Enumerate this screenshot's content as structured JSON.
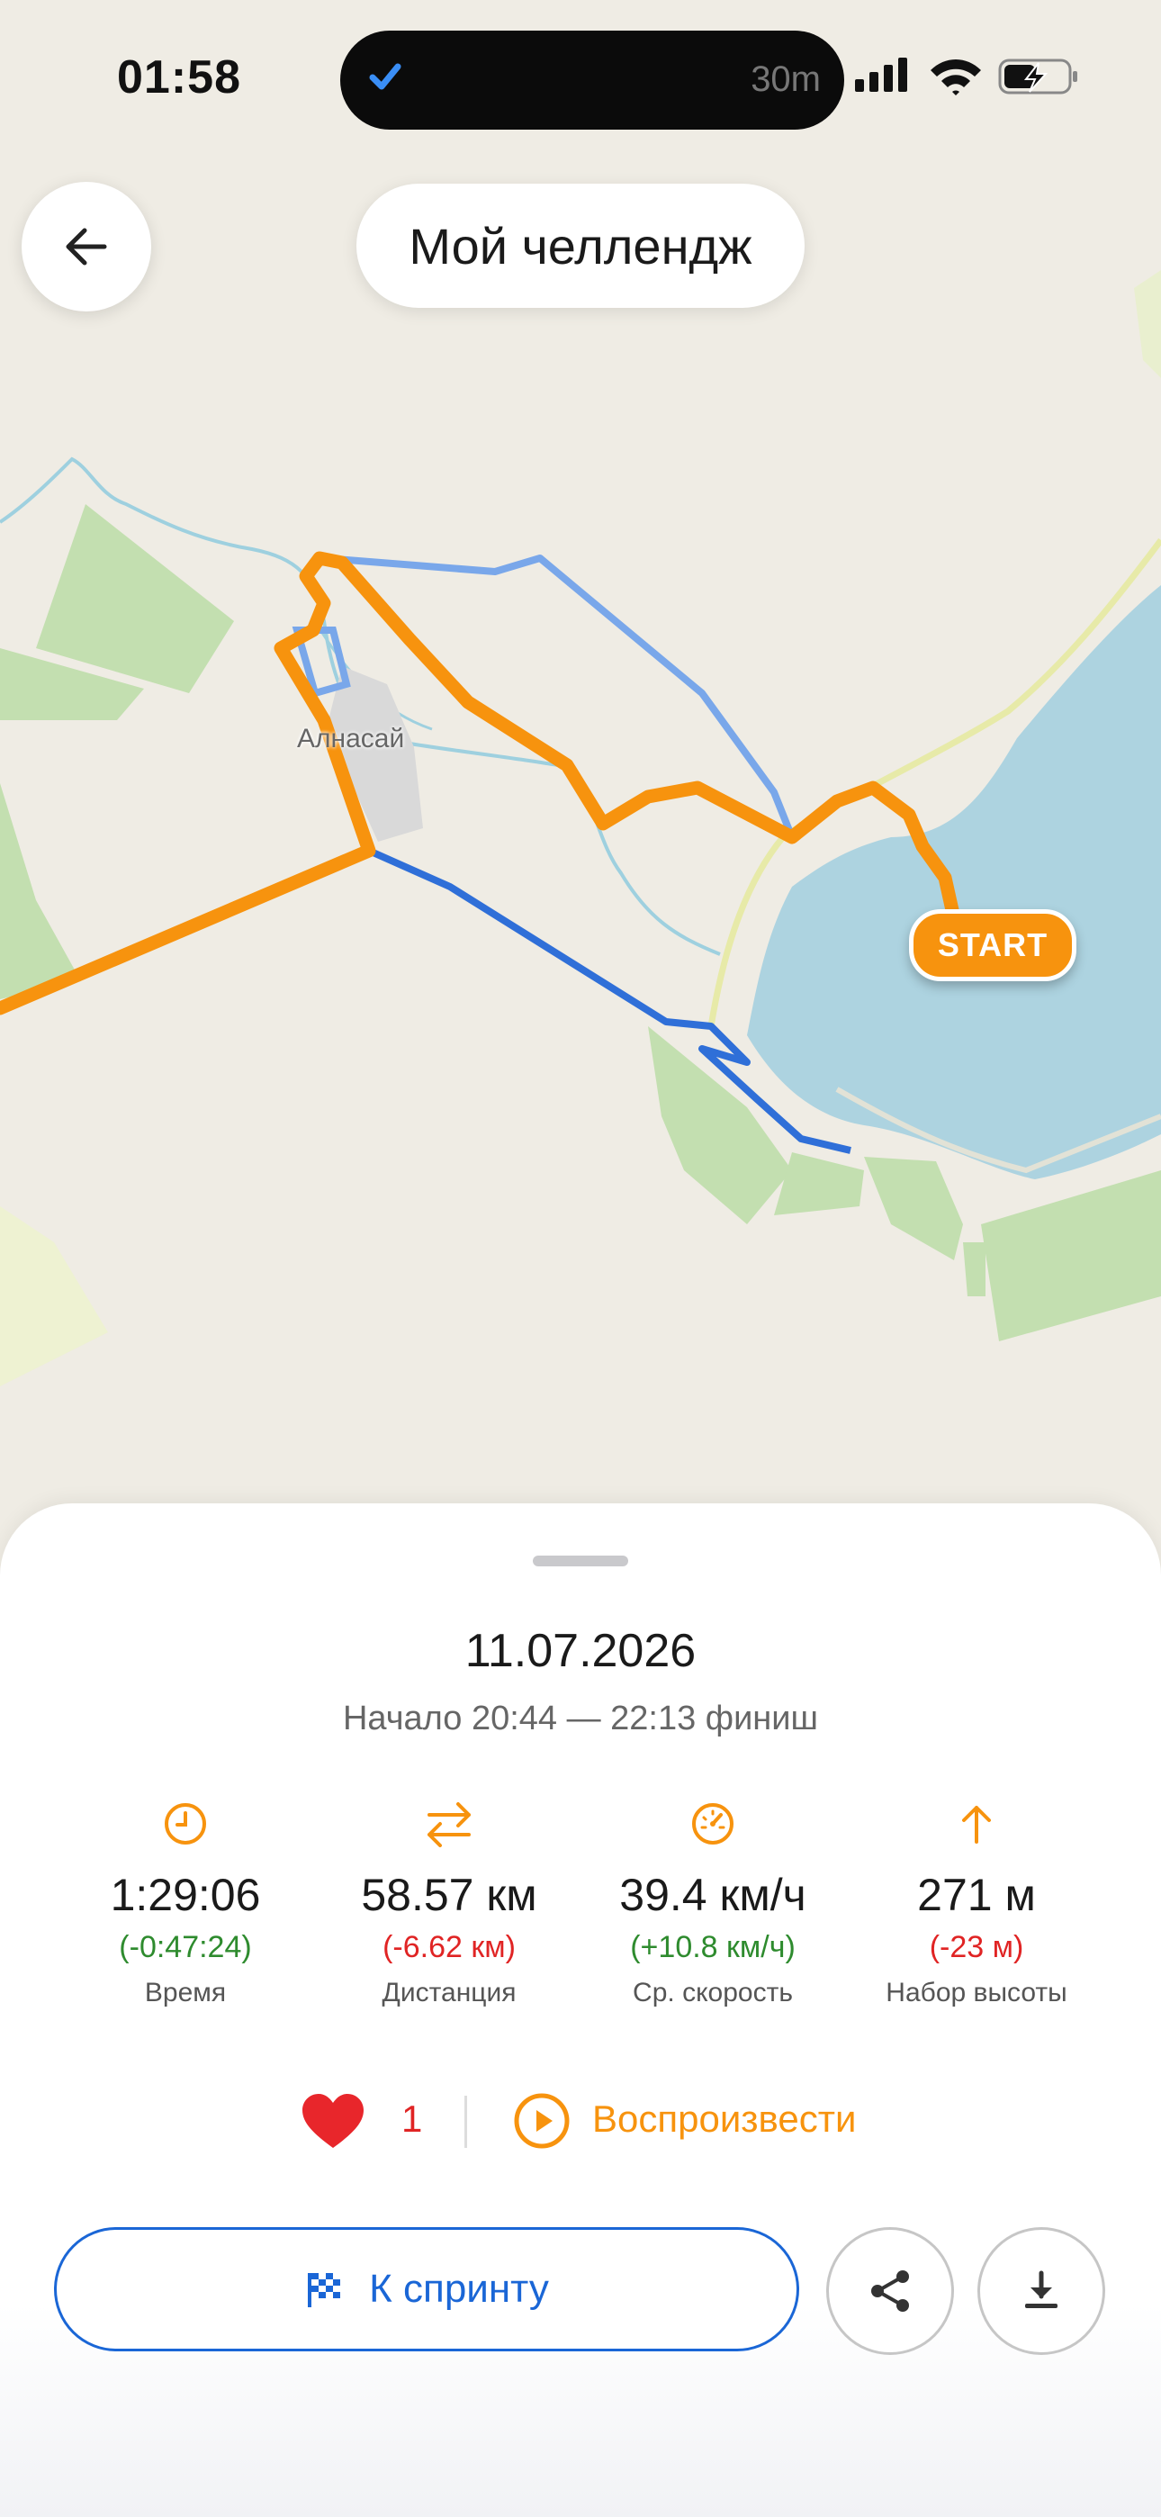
{
  "status_bar": {
    "time": "01:58",
    "timer": "30m"
  },
  "header": {
    "title": "Мой челлендж"
  },
  "map": {
    "town_label": "Алнасай",
    "start_label": "START"
  },
  "details": {
    "date": "11.07.2026",
    "range": "Начало 20:44 — 22:13 финиш",
    "stats": [
      {
        "value": "1:29:06",
        "delta": "(-0:47:24)",
        "label": "Время",
        "icon": "clock-icon",
        "delta_color": "green"
      },
      {
        "value": "58.57 км",
        "delta": "(-6.62 км)",
        "label": "Дистанция",
        "icon": "distance-arrows-icon",
        "delta_color": "red"
      },
      {
        "value": "39.4 км/ч",
        "delta": "(+10.8 км/ч)",
        "label": "Ср. скорость",
        "icon": "speedometer-icon",
        "delta_color": "green"
      },
      {
        "value": "271 м",
        "delta": "(-23 м)",
        "label": "Набор высоты",
        "icon": "arrow-up-icon",
        "delta_color": "red"
      }
    ]
  },
  "actions": {
    "likes": "1",
    "replay_label": "Воспроизвести",
    "sprint_label": "К спринту"
  },
  "colors": {
    "accent": "#f7930e",
    "blue": "#1a66d6",
    "green": "#2e8b2e",
    "red": "#e02424"
  }
}
